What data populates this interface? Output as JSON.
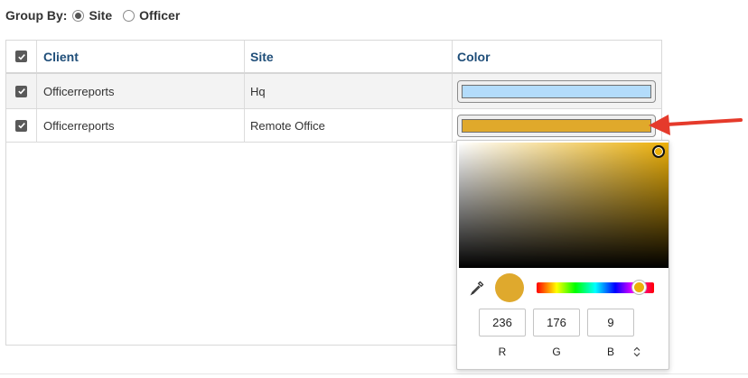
{
  "group_by": {
    "label": "Group By:",
    "options": [
      {
        "label": "Site",
        "selected": true
      },
      {
        "label": "Officer",
        "selected": false
      }
    ]
  },
  "table": {
    "columns": [
      "Client",
      "Site",
      "Color"
    ],
    "rows": [
      {
        "checked": true,
        "client": "Officerreports",
        "site": "Hq",
        "color": "#b3dcfb"
      },
      {
        "checked": true,
        "client": "Officerreports",
        "site": "Remote Office",
        "color": "#e0a92b"
      }
    ]
  },
  "picker": {
    "hue_color": "#ecb009",
    "current_color": "#dfa92d",
    "r": "236",
    "g": "176",
    "b": "9",
    "labels": {
      "r": "R",
      "g": "G",
      "b": "B"
    }
  },
  "colors": {
    "header_text": "#1f4e79",
    "arrow": "#e53a2b"
  }
}
